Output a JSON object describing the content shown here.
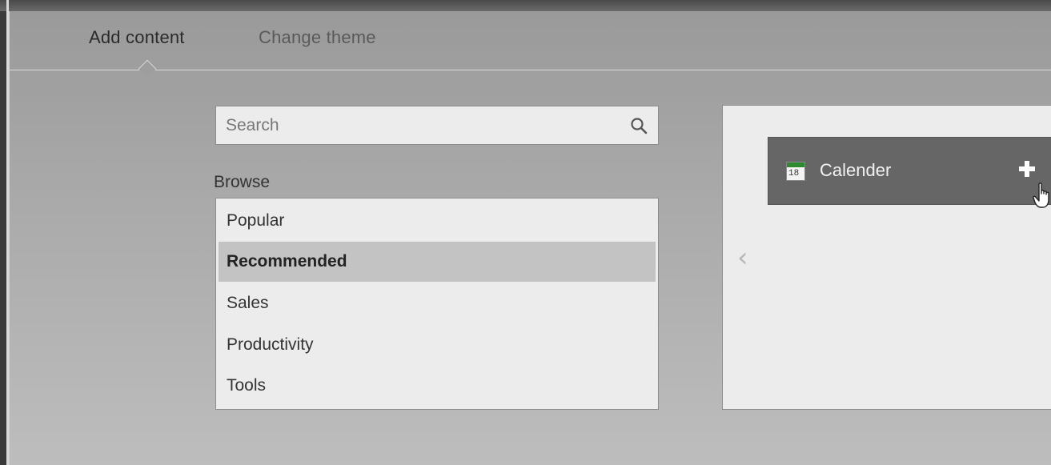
{
  "tabs": {
    "add_content": "Add content",
    "change_theme": "Change theme"
  },
  "search": {
    "placeholder": "Search"
  },
  "browse": {
    "label": "Browse",
    "items": [
      {
        "label": "Popular",
        "selected": false
      },
      {
        "label": "Recommended",
        "selected": true
      },
      {
        "label": "Sales",
        "selected": false
      },
      {
        "label": "Productivity",
        "selected": false
      },
      {
        "label": "Tools",
        "selected": false
      }
    ]
  },
  "content": {
    "card": {
      "label": "Calender",
      "icon": "calendar-icon",
      "icon_day": "18",
      "action_icon": "plus-icon"
    },
    "prev_icon": "chevron-left-icon",
    "prev_glyph": "‹"
  },
  "colors": {
    "selected_bg": "#c3c3c3",
    "card_bg": "#666666",
    "calendar_green": "#2f8a2f"
  }
}
